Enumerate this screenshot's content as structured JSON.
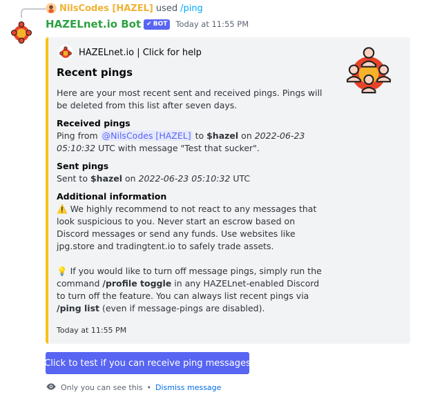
{
  "reply": {
    "username": "NilsCodes [HAZEL]",
    "action": "used",
    "command": "/ping"
  },
  "message": {
    "bot_name": "HAZELnet.io Bot",
    "badge": "BOT",
    "timestamp": "Today at 11:55 PM"
  },
  "embed": {
    "accent_color": "#f6c218",
    "author": "HAZELnet.io | Click for help",
    "title": "Recent pings",
    "description": "Here are your most recent sent and received pings. Pings will be deleted from this list after seven days.",
    "received": {
      "name": "Received pings",
      "prefix": "Ping from",
      "mention": "@NilsCodes [HAZEL]",
      "to": "to",
      "handle": "$hazel",
      "on": "on",
      "date": "2022-06-23 05:10:32",
      "suffix": "UTC with message \"Test that sucker\"."
    },
    "sent": {
      "name": "Sent pings",
      "prefix": "Sent to",
      "handle": "$hazel",
      "on": "on",
      "date": "2022-06-23 05:10:32",
      "suffix": "UTC"
    },
    "additional": {
      "name": "Additional information",
      "warning_icon": "warning-icon",
      "warning": "We highly recommend to not react to any messages that look suspicious to you. Never start an escrow based on Discord messages or send any funds. Use websites like jpg.store and tradingtent.io to safely trade assets.",
      "tip_icon": "lightbulb-icon",
      "tip_part1": "If you would like to turn off message pings, simply run the command",
      "tip_cmd1": "/profile toggle",
      "tip_part2": "in any HAZELnet-enabled Discord to turn off the feature. You can always list recent pings via",
      "tip_cmd2": "/ping list",
      "tip_part3": "(even if message-pings are disabled)."
    },
    "footer_timestamp": "Today at 11:55 PM"
  },
  "button": {
    "label": "Click to test if you can receive ping messages",
    "color": "#5865f2"
  },
  "ephemeral": {
    "text": "Only you can see this",
    "separator": "•",
    "dismiss": "Dismiss message"
  }
}
